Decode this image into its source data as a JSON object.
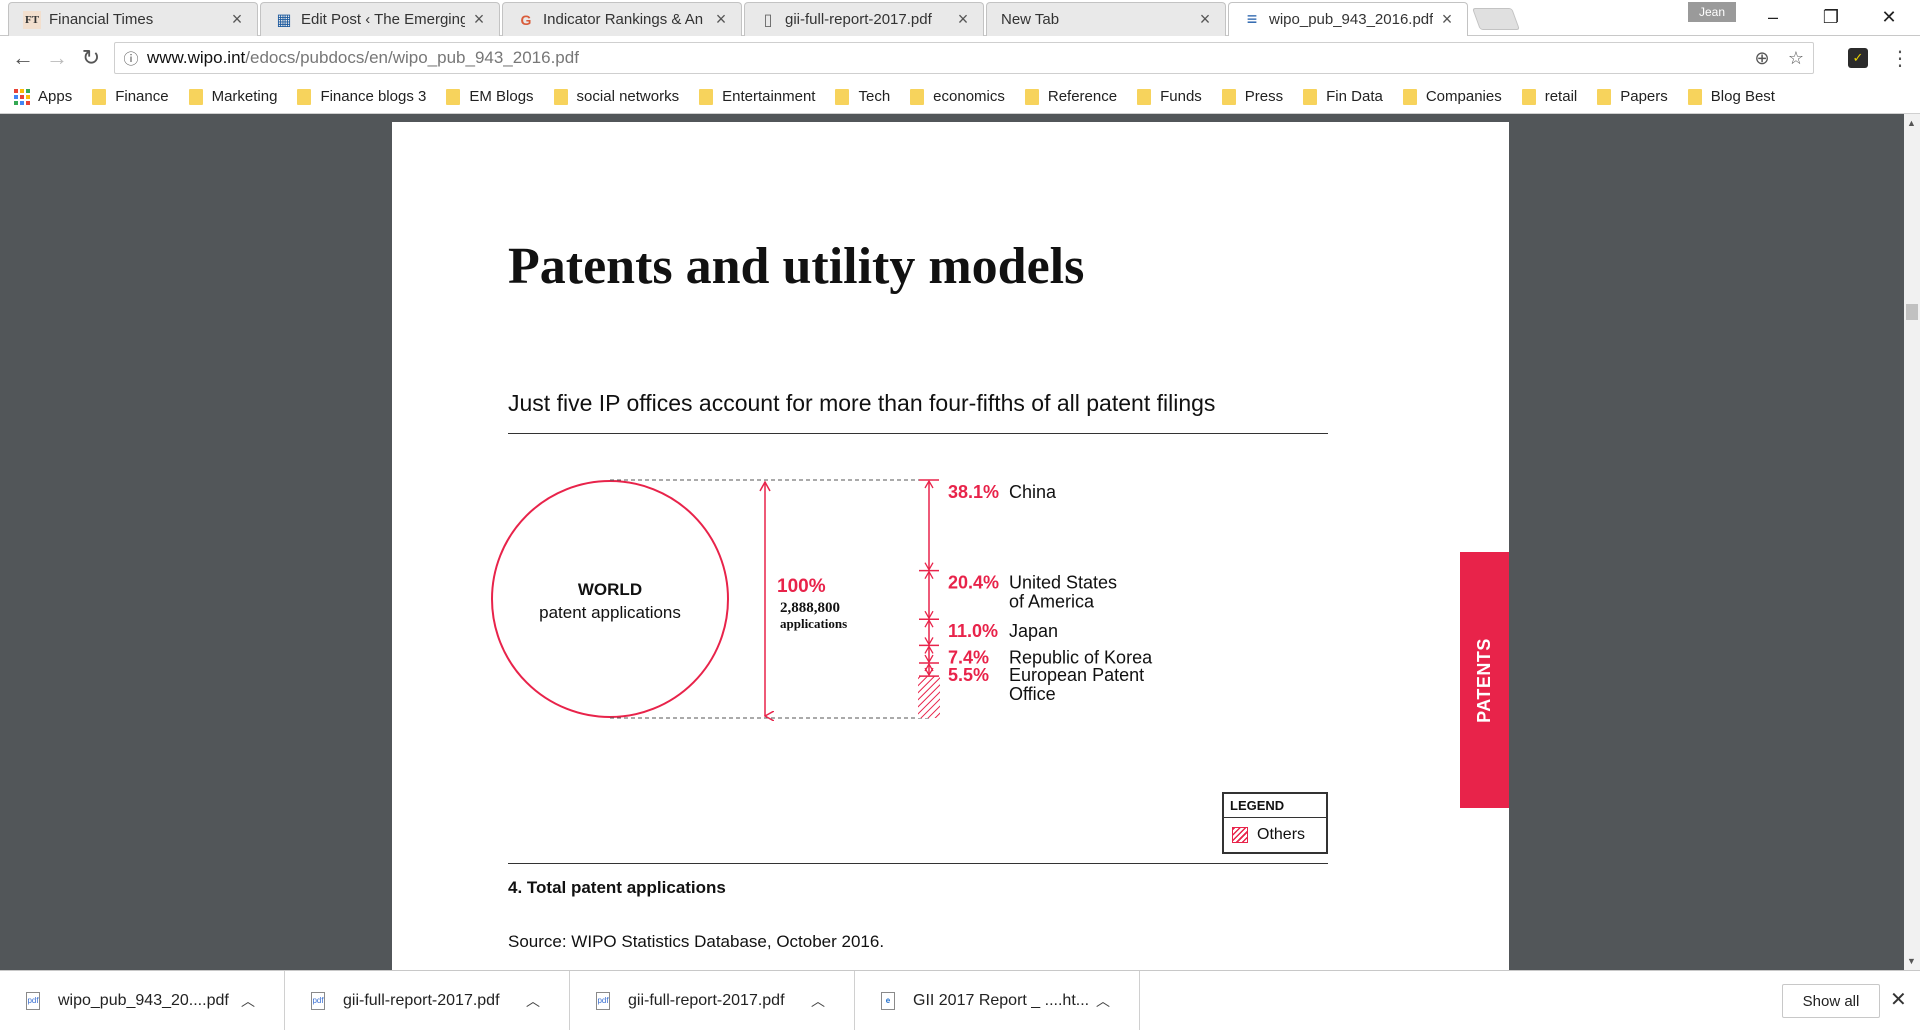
{
  "tabs": [
    {
      "label": "Financial Times",
      "favicon": "FT"
    },
    {
      "label": "Edit Post ‹ The Emerging",
      "favicon": "▦"
    },
    {
      "label": "Indicator Rankings & An",
      "favicon": "G"
    },
    {
      "label": "gii-full-report-2017.pdf",
      "favicon": "▯"
    },
    {
      "label": "New Tab",
      "favicon": ""
    },
    {
      "label": "wipo_pub_943_2016.pdf",
      "favicon": "≡"
    }
  ],
  "user_badge": "Jean",
  "address": {
    "host": "www.wipo.int",
    "path": "/edocs/pubdocs/en/wipo_pub_943_2016.pdf"
  },
  "bookmarks": [
    "Apps",
    "Finance",
    "Marketing",
    "Finance blogs 3",
    "EM Blogs",
    "social networks",
    "Entertainment",
    "Tech",
    "economics",
    "Reference",
    "Funds",
    "Press",
    "Fin Data",
    "Companies",
    "retail",
    "Papers",
    "Blog Best"
  ],
  "document": {
    "title": "Patents and utility models",
    "chart_heading": "Just five IP offices account for more than four-fifths of all patent filings",
    "side_tab": "PATENTS",
    "figure_caption": "4. Total patent applications",
    "source": "Source: WIPO Statistics Database, October 2016."
  },
  "chart_data": {
    "type": "bar",
    "title": "Just five IP offices account for more than four-fifths of all patent filings",
    "circle_label_bold": "WORLD",
    "circle_label": "patent applications",
    "total_percent": "100%",
    "total_count": "2,888,800",
    "total_unit": "applications",
    "categories": [
      "China",
      "United States of America",
      "Japan",
      "Republic of Korea",
      "European Patent Office",
      "Others"
    ],
    "values": [
      38.1,
      20.4,
      11.0,
      7.4,
      5.5,
      17.6
    ],
    "value_labels": [
      "38.1%",
      "20.4%",
      "11.0%",
      "7.4%",
      "5.5%",
      ""
    ],
    "label_lines": [
      [
        "China"
      ],
      [
        "United States",
        "of America"
      ],
      [
        "Japan"
      ],
      [
        "Republic of Korea"
      ],
      [
        "European Patent",
        "Office"
      ],
      []
    ],
    "legend": {
      "title": "LEGEND",
      "items": [
        "Others"
      ]
    },
    "accent_color": "#e8234a"
  },
  "downloads": [
    {
      "label": "wipo_pub_943_20....pdf"
    },
    {
      "label": "gii-full-report-2017.pdf"
    },
    {
      "label": "gii-full-report-2017.pdf"
    },
    {
      "label": "GII 2017 Report _ ....ht..."
    }
  ],
  "downloads_show_all": "Show all"
}
